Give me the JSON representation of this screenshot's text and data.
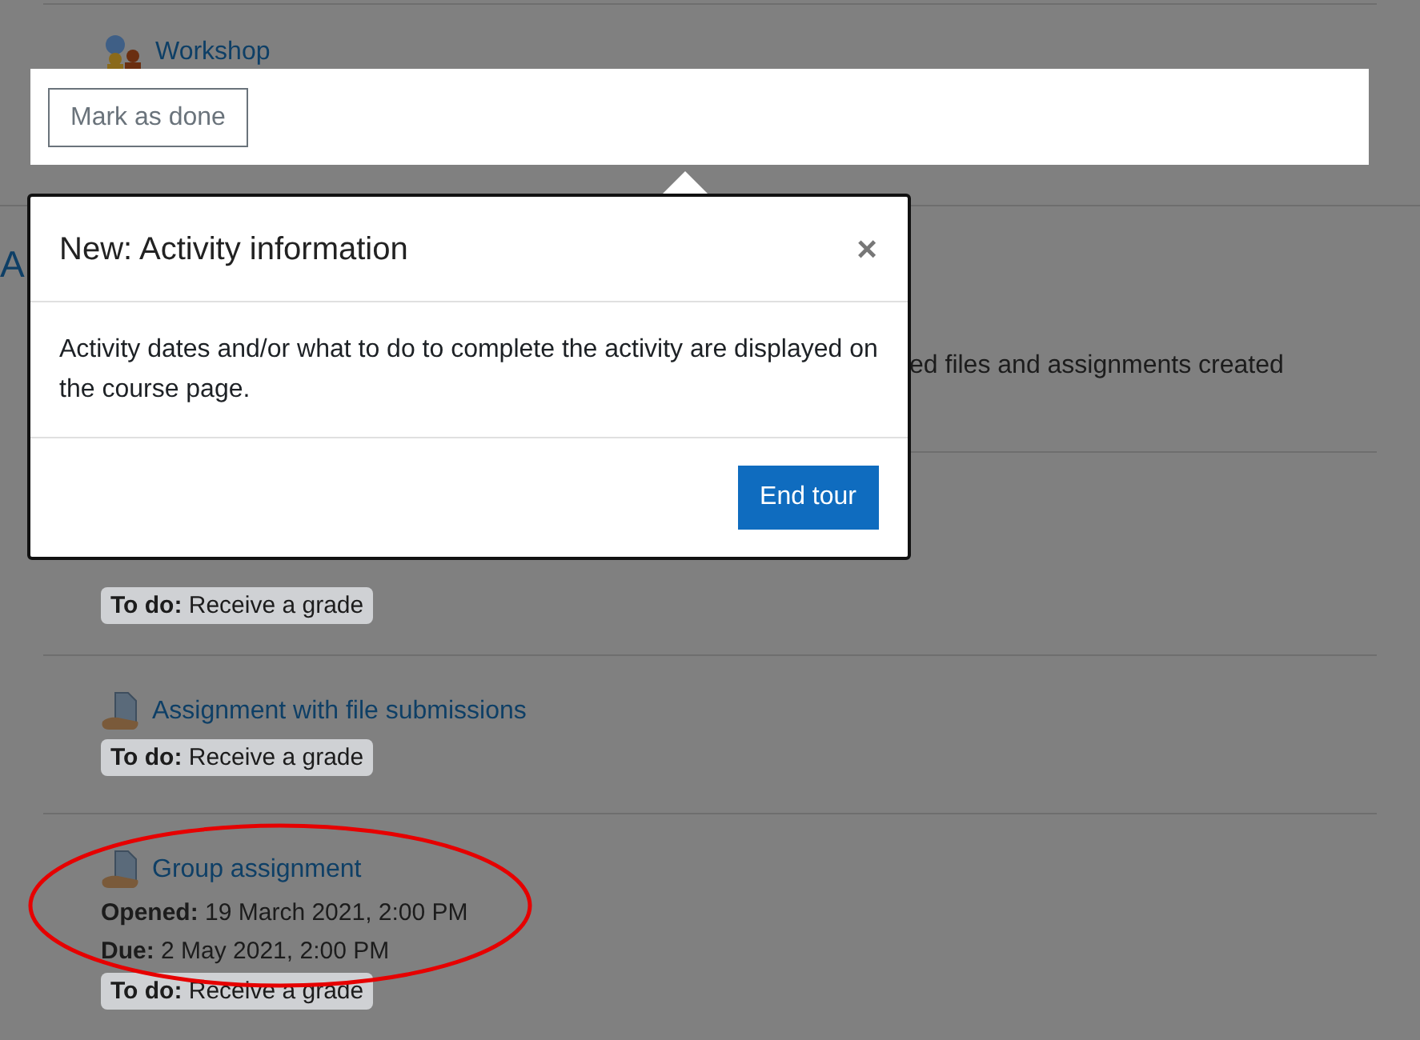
{
  "section": {
    "heading": "A",
    "text": "ed files and assignments created"
  },
  "activities": [
    {
      "kind": "workshop",
      "title": "Workshop"
    },
    {
      "kind": "hidden",
      "todo": "**To do:** Receive a grade"
    },
    {
      "kind": "assignment",
      "title": "Assignment with file submissions",
      "todo": "**To do:** Receive a grade"
    },
    {
      "kind": "assignment",
      "title": "Group assignment",
      "dates": [
        "**Opened:** 19 March 2021, 2:00 PM",
        "**Due:** 2 May 2021, 2:00 PM"
      ],
      "todo": "**To do:** Receive a grade"
    }
  ],
  "highlight": {
    "button": "Mark as done"
  },
  "tour": {
    "title": "New: Activity information",
    "close": "×",
    "body": "Activity dates and/or what to do to complete the activity are displayed on the course page.",
    "button": "End tour"
  }
}
